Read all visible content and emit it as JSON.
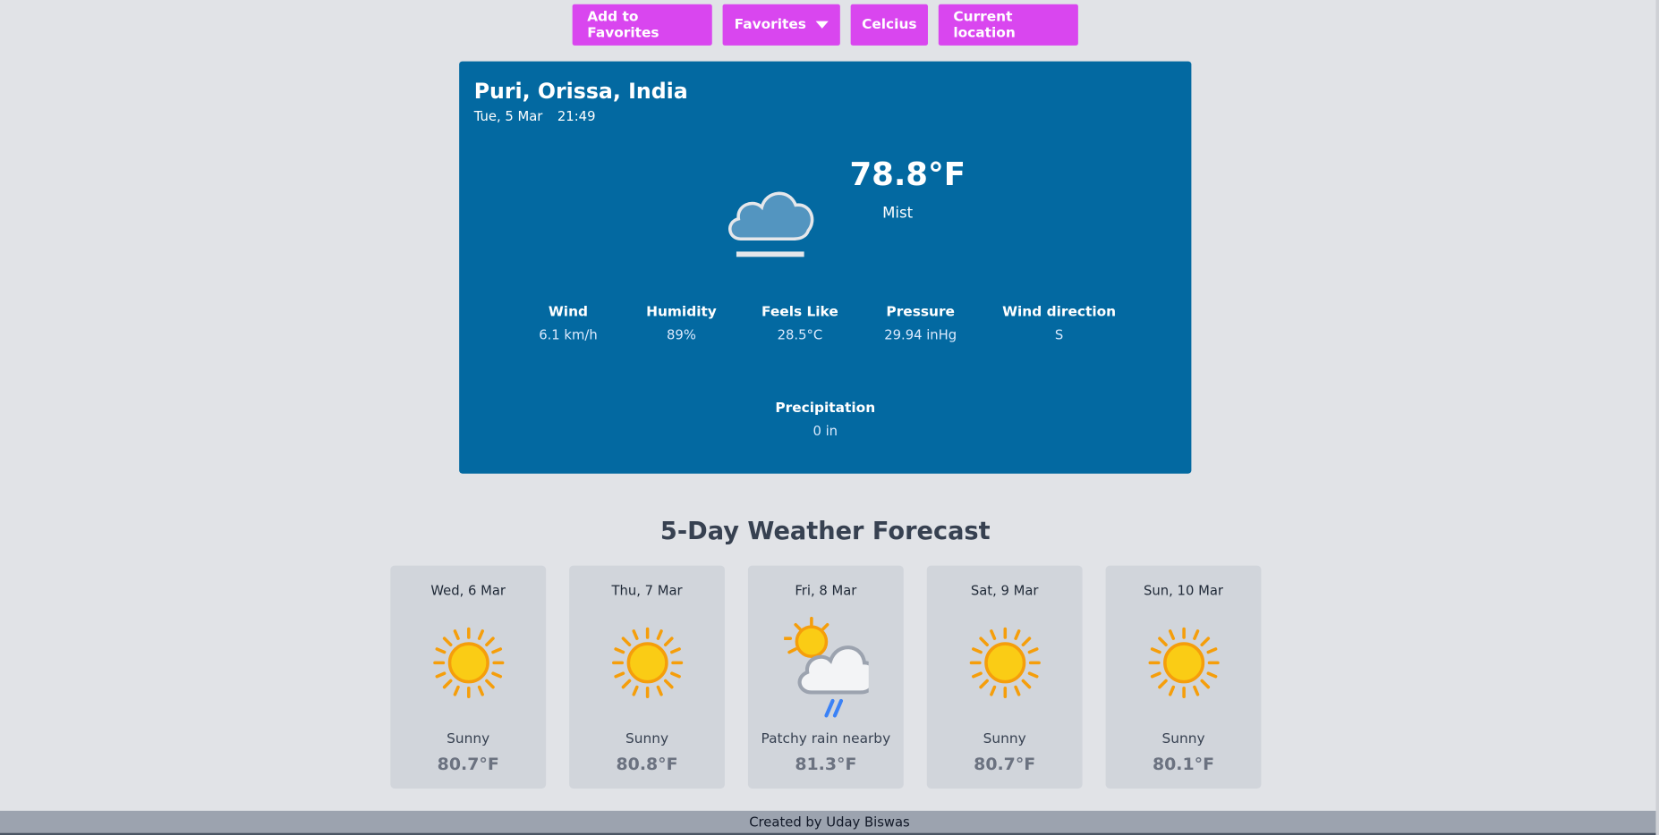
{
  "toolbar": {
    "add_favorites": "Add to Favorites",
    "favorites": "Favorites",
    "unit_toggle": "Celcius",
    "current_location": "Current location"
  },
  "current": {
    "location": "Puri, Orissa, India",
    "date": "Tue, 5 Mar",
    "time": "21:49",
    "temperature": "78.8°F",
    "condition": "Mist",
    "icon": "mist-icon",
    "stats": [
      {
        "label": "Wind",
        "value": "6.1 km/h"
      },
      {
        "label": "Humidity",
        "value": "89%"
      },
      {
        "label": "Feels Like",
        "value": "28.5°C"
      },
      {
        "label": "Pressure",
        "value": "29.94 inHg"
      },
      {
        "label": "Wind direction",
        "value": "S"
      },
      {
        "label": "Precipitation",
        "value": "0 in"
      }
    ]
  },
  "forecast": {
    "title": "5-Day Weather Forecast",
    "days": [
      {
        "date": "Wed, 6 Mar",
        "condition": "Sunny",
        "temp": "80.7°F",
        "icon": "sun-icon"
      },
      {
        "date": "Thu, 7 Mar",
        "condition": "Sunny",
        "temp": "80.8°F",
        "icon": "sun-icon"
      },
      {
        "date": "Fri, 8 Mar",
        "condition": "Patchy rain nearby",
        "temp": "81.3°F",
        "icon": "patchy-rain-icon"
      },
      {
        "date": "Sat, 9 Mar",
        "condition": "Sunny",
        "temp": "80.7°F",
        "icon": "sun-icon"
      },
      {
        "date": "Sun, 10 Mar",
        "condition": "Sunny",
        "temp": "80.1°F",
        "icon": "sun-icon"
      }
    ]
  },
  "footer": {
    "credit": "Created by Uday Biswas"
  },
  "colors": {
    "button": "#d946ef",
    "card": "#0369a1",
    "background": "#e1e3e7",
    "forecast_card": "#d1d5db"
  }
}
